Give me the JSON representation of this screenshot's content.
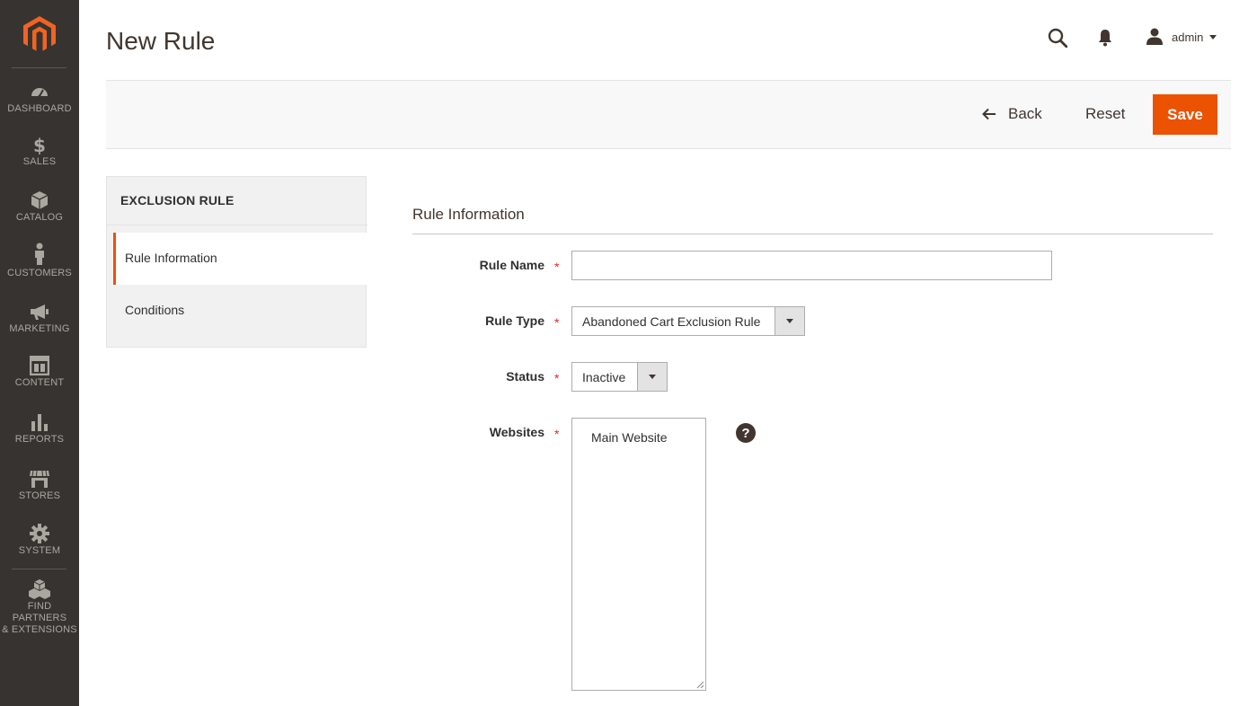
{
  "sidebar": {
    "logo": "magento-logo-icon",
    "items": [
      {
        "label": "DASHBOARD",
        "icon": "dashboard-icon"
      },
      {
        "label": "SALES",
        "icon": "dollar-icon"
      },
      {
        "label": "CATALOG",
        "icon": "box-icon"
      },
      {
        "label": "CUSTOMERS",
        "icon": "person-icon"
      },
      {
        "label": "MARKETING",
        "icon": "megaphone-icon"
      },
      {
        "label": "CONTENT",
        "icon": "layout-icon"
      },
      {
        "label": "REPORTS",
        "icon": "bar-chart-icon"
      },
      {
        "label": "STORES",
        "icon": "storefront-icon"
      },
      {
        "label": "SYSTEM",
        "icon": "gear-icon"
      },
      {
        "label_line1": "FIND PARTNERS",
        "label_line2": "& EXTENSIONS",
        "icon": "cubes-icon"
      }
    ]
  },
  "header": {
    "title": "New Rule",
    "user": "admin"
  },
  "actions": {
    "back": "Back",
    "reset": "Reset",
    "save": "Save"
  },
  "tabs": {
    "title": "EXCLUSION RULE",
    "items": [
      {
        "label": "Rule Information",
        "active": true
      },
      {
        "label": "Conditions",
        "active": false
      }
    ]
  },
  "form": {
    "section_title": "Rule Information",
    "rule_name": {
      "label": "Rule Name",
      "value": "",
      "required": "*"
    },
    "rule_type": {
      "label": "Rule Type",
      "value": "Abandoned Cart Exclusion Rule",
      "required": "*"
    },
    "status": {
      "label": "Status",
      "value": "Inactive",
      "required": "*"
    },
    "websites": {
      "label": "Websites",
      "options": [
        "Main Website"
      ],
      "required": "*",
      "help": "?"
    }
  },
  "colors": {
    "sidebar_bg": "#373330",
    "accent": "#eb5202",
    "required": "#e22626"
  }
}
